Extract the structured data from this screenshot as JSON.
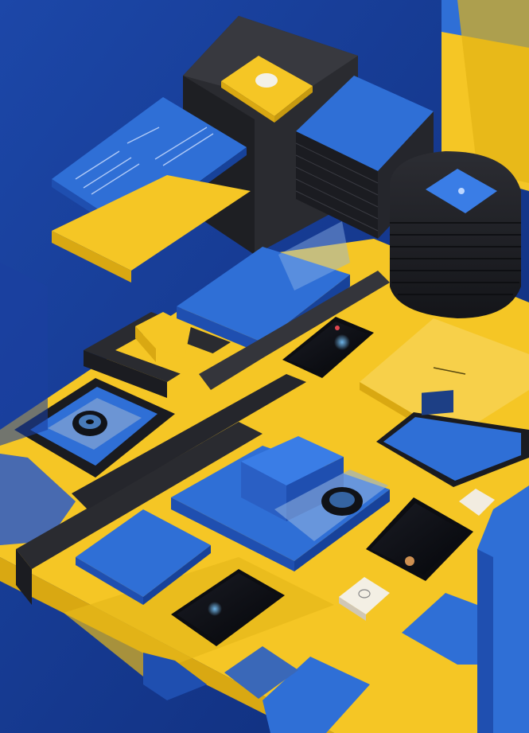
{
  "scene": {
    "description_visible_text": [],
    "colors": {
      "background": "#173a93",
      "yellow": "#f5c625",
      "yellow_shadow": "#d9a812",
      "blue": "#2f6fd6",
      "blue_dark": "#1f4fb0",
      "charcoal": "#2a2b30",
      "black": "#111216"
    },
    "icons": [
      "smartphone-icon",
      "speaker-icon",
      "tablet-icon",
      "button-icon"
    ]
  }
}
